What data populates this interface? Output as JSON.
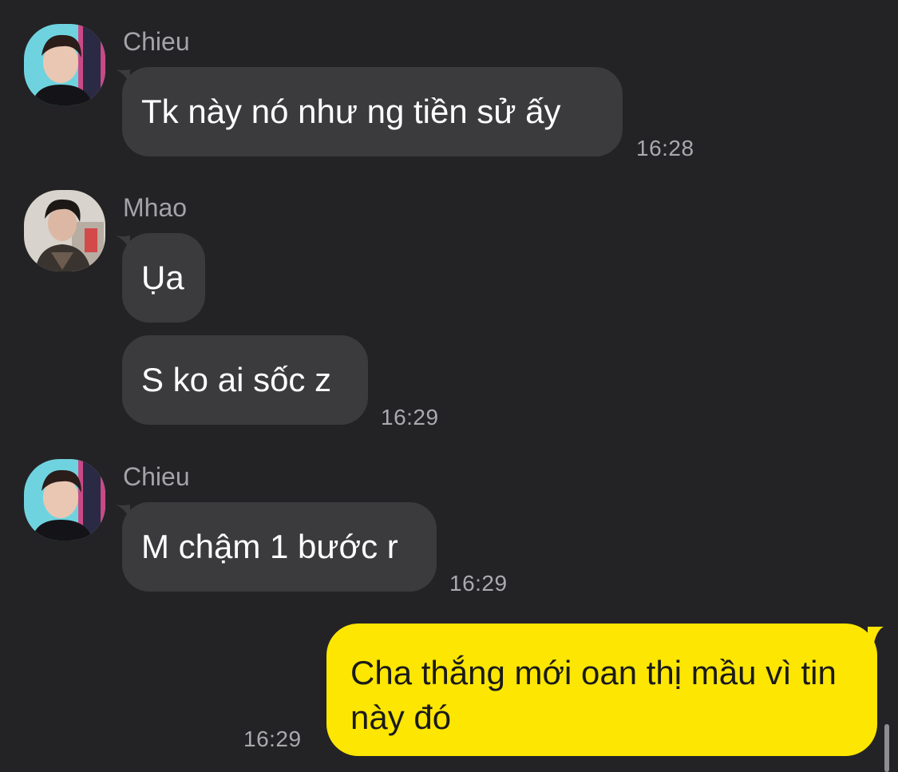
{
  "messages": [
    {
      "sender": "Chieu",
      "text": "Tk này nó như ng tiền sử ấy",
      "time": "16:28"
    },
    {
      "sender": "Mhao",
      "text": "Ụa",
      "time": ""
    },
    {
      "sender": "Mhao",
      "text": "S ko ai sốc z",
      "time": "16:29"
    },
    {
      "sender": "Chieu",
      "text": "M chậm 1 bước r",
      "time": "16:29"
    },
    {
      "sender": "me",
      "text": "Cha thắng mới oan thị mầu vì tin này đó",
      "time": "16:29"
    }
  ],
  "colors": {
    "background": "#232325",
    "incoming_bubble": "#3b3b3e",
    "outgoing_bubble": "#fde601"
  }
}
